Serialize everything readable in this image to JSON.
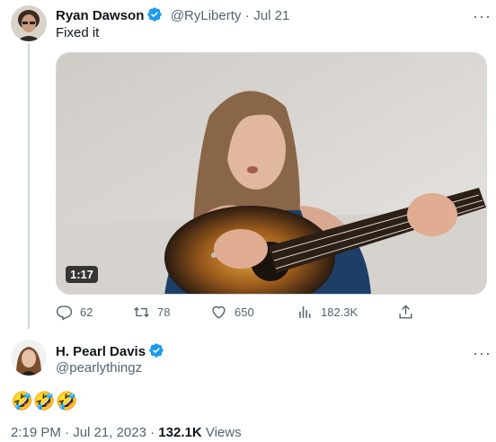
{
  "original_tweet": {
    "author_name": "Ryan Dawson",
    "handle": "@RyLiberty",
    "separator": "·",
    "date": "Jul 21",
    "text": "Fixed it",
    "video_duration": "1:17",
    "stats": {
      "replies": "62",
      "retweets": "78",
      "likes": "650",
      "views": "182.3K"
    }
  },
  "reply_tweet": {
    "author_name": "H. Pearl Davis",
    "handle": "@pearlythingz",
    "text": "🤣🤣🤣",
    "time": "2:19 PM",
    "separator_1": "·",
    "date": "Jul 21, 2023",
    "separator_2": "·",
    "views_count": "132.1K",
    "views_label": "Views"
  },
  "icons": {
    "more": "more-horizontal-icon",
    "verified": "verified-badge-icon",
    "reply": "reply-icon",
    "retweet": "retweet-icon",
    "like": "heart-icon",
    "views": "analytics-icon",
    "share": "share-icon"
  },
  "colors": {
    "verified_blue": "#1d9bf0",
    "muted_text": "#536471",
    "primary_text": "#0f1419"
  }
}
